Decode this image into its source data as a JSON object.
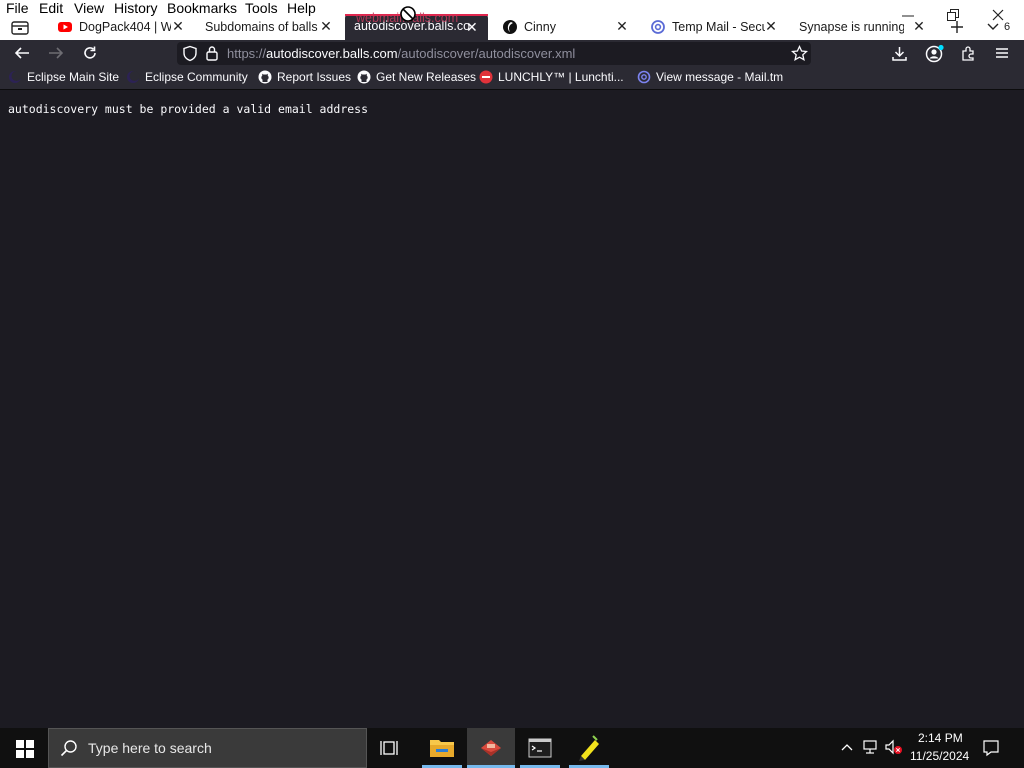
{
  "menu": {
    "file": "File",
    "edit": "Edit",
    "view": "View",
    "history": "History",
    "bookmarks": "Bookmarks",
    "tools": "Tools",
    "help": "Help"
  },
  "tabs": [
    {
      "label": "DogPack404 | Wil",
      "icon": "youtube-icon"
    },
    {
      "label": "Subdomains of balls.c",
      "icon": "none"
    },
    {
      "label": "autodiscover.balls.co",
      "icon": "none",
      "active": true
    },
    {
      "label": "Cinny",
      "icon": "cinny-icon"
    },
    {
      "label": "Temp Mail - Secu",
      "icon": "at-icon"
    },
    {
      "label": "Synapse is running",
      "icon": "none"
    }
  ],
  "tab_overlay_text": "webmail.balls.com",
  "tab_count": "6",
  "url": {
    "prefix": "https://",
    "host": "autodiscover.balls.com",
    "path": "/autodiscover/autodiscover.xml"
  },
  "bookmarks": [
    {
      "label": "Eclipse Main Site",
      "icon": "eclipse-icon"
    },
    {
      "label": "Eclipse Community",
      "icon": "eclipse-icon"
    },
    {
      "label": "Report Issues",
      "icon": "github-icon"
    },
    {
      "label": "Get New Releases",
      "icon": "github-icon"
    },
    {
      "label": "LUNCHLY™ | Lunchti...",
      "icon": "lunchly-icon"
    },
    {
      "label": "View message - Mail.tm",
      "icon": "at-icon"
    }
  ],
  "page": {
    "body_text": "autodiscovery must be provided a valid email address"
  },
  "taskbar": {
    "search_placeholder": "Type here to search",
    "time": "2:14 PM",
    "date": "11/25/2024"
  },
  "colors": {
    "content_bg": "#1c1b22",
    "toolbar_bg": "#2b2a33",
    "active_tab_accent": "#e1264e",
    "taskbar_bg": "#101010"
  }
}
